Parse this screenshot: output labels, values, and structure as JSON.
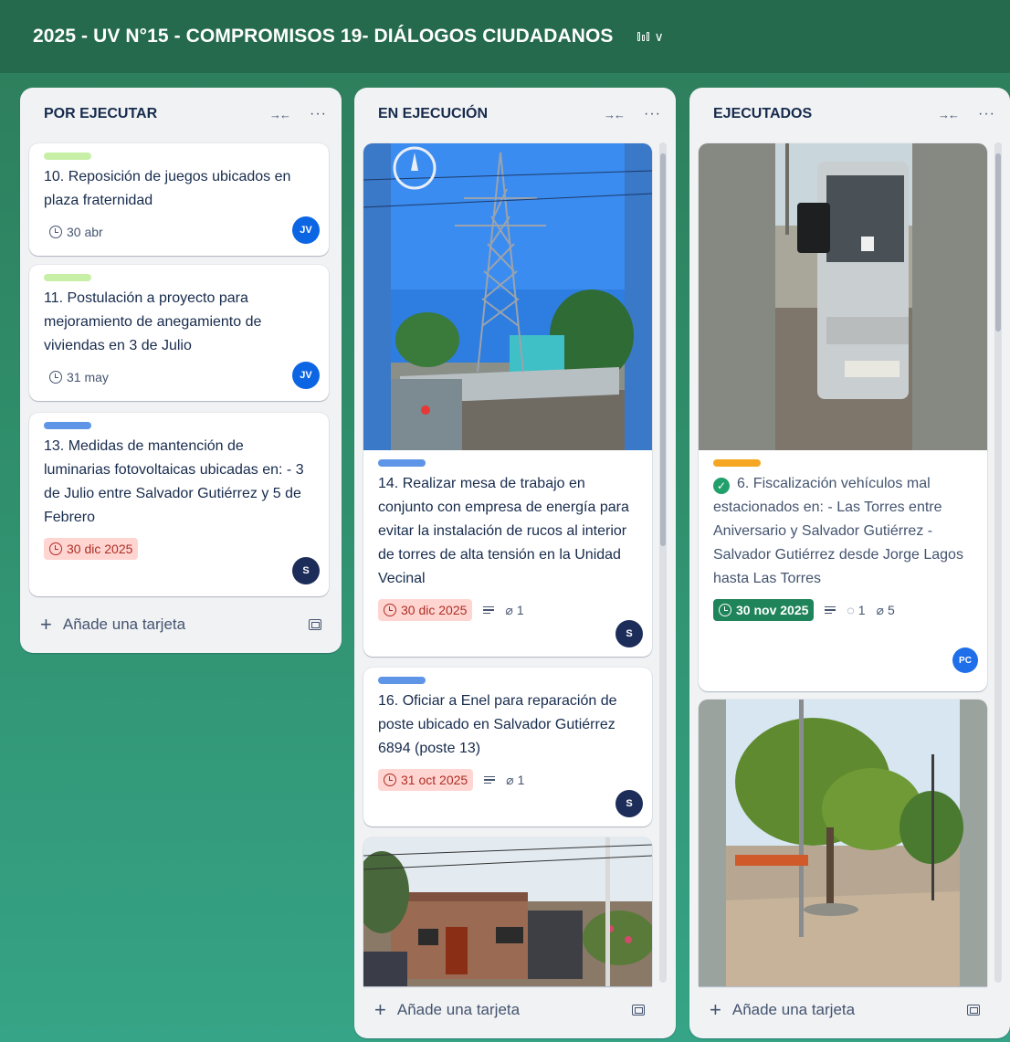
{
  "board": {
    "title": "2025 - UV N°15 - COMPROMISOS 19- DIÁLOGOS CIUDADANOS"
  },
  "lists": [
    {
      "title": "POR EJECUTAR",
      "add_card": "Añade una tarjeta",
      "cards": [
        {
          "label_color": "#baf3a5",
          "title": "10. Reposición de juegos ubicados en plaza fraternidad",
          "due": "30 abr",
          "avatar": "JV"
        },
        {
          "label_color": "#baf3a5",
          "title": "11. Postulación a proyecto para mejoramiento de anegamiento de viviendas en 3 de Julio",
          "due": "31 may",
          "avatar": "JV"
        },
        {
          "label_color": "#579dff",
          "title": "13. Medidas de mantención de luminarias fotovoltaicas ubicadas en: - 3 de Julio entre Salvador Gutiérrez y 5 de Febrero",
          "due": "30 dic 2025",
          "avatar": "S"
        }
      ]
    },
    {
      "title": "EN EJECUCIÓN",
      "add_card": "Añade una tarjeta",
      "cards": [
        {
          "label_color": "#579dff",
          "title": "14. Realizar mesa de trabajo en conjunto con empresa de energía para evitar la instalación de rucos al interior de torres de alta tensión en la Unidad Vecinal",
          "due": "30 dic 2025",
          "attachments": "1",
          "avatar": "S"
        },
        {
          "label_color": "#579dff",
          "title": "16. Oficiar a Enel para reparación de poste ubicado en Salvador Gutiérrez 6894 (poste 13)",
          "due": "31 oct 2025",
          "attachments": "1",
          "avatar": "S"
        }
      ]
    },
    {
      "title": "EJECUTADOS",
      "add_card": "Añade una tarjeta",
      "cards": [
        {
          "label_color": "#f5a623",
          "title": "6. Fiscalización vehículos mal estacionados en: - Las Torres entre Aniversario y Salvador Gutiérrez - Salvador Gutiérrez desde Jorge Lagos hasta Las Torres",
          "due": "30 nov 2025",
          "comments": "1",
          "attachments": "5",
          "avatar": "PC"
        }
      ]
    }
  ]
}
